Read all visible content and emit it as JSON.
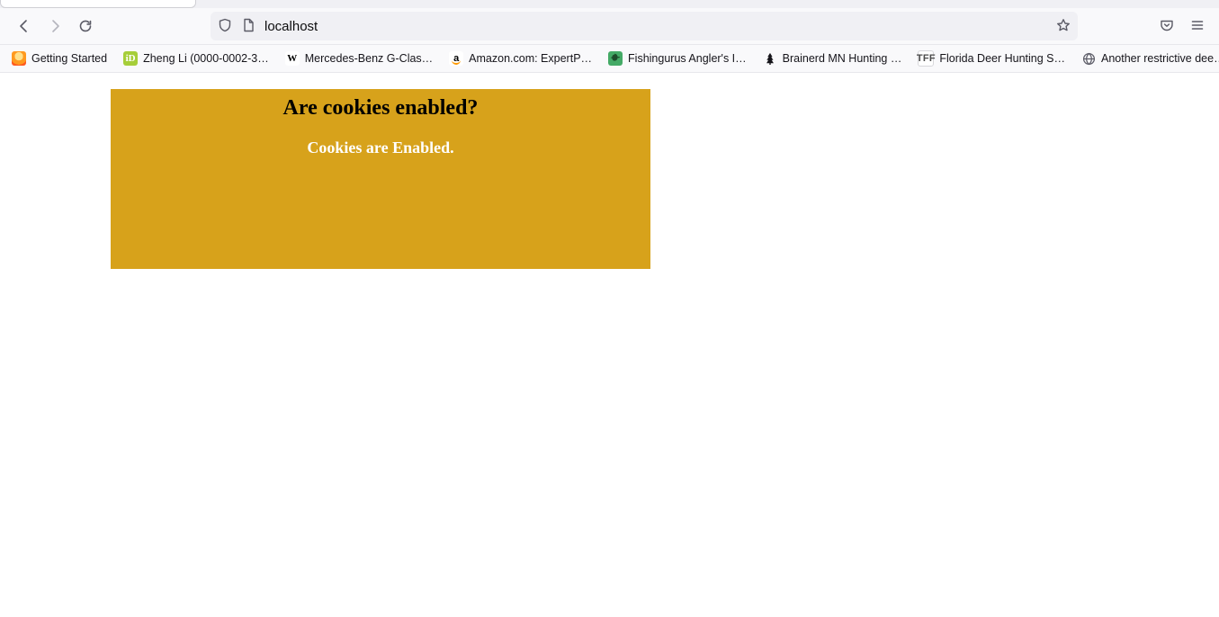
{
  "url": "localhost",
  "bookmarks": [
    {
      "label": "Getting Started",
      "icon": "fire"
    },
    {
      "label": "Zheng Li (0000-0002-3…",
      "icon": "orcid"
    },
    {
      "label": "Mercedes-Benz G-Clas…",
      "icon": "wiki"
    },
    {
      "label": "Amazon.com: ExpertP…",
      "icon": "amazon"
    },
    {
      "label": "Fishingurus Angler's I…",
      "icon": "fish"
    },
    {
      "label": "Brainerd MN Hunting …",
      "icon": "tree"
    },
    {
      "label": "Florida Deer Hunting S…",
      "icon": "tff"
    },
    {
      "label": "Another restrictive dee…",
      "icon": "globe"
    }
  ],
  "page": {
    "heading": "Are cookies enabled?",
    "status": "Cookies are Enabled."
  }
}
